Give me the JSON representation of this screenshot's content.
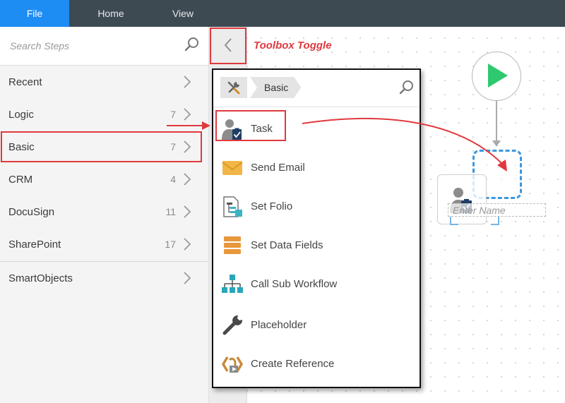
{
  "menu": {
    "file": "File",
    "home": "Home",
    "view": "View"
  },
  "search": {
    "placeholder": "Search Steps"
  },
  "categories": [
    {
      "label": "Recent",
      "count": ""
    },
    {
      "label": "Logic",
      "count": "7"
    },
    {
      "label": "Basic",
      "count": "7"
    },
    {
      "label": "CRM",
      "count": "4"
    },
    {
      "label": "DocuSign",
      "count": "11"
    },
    {
      "label": "SharePoint",
      "count": "17"
    },
    {
      "label": "SmartObjects",
      "count": ""
    }
  ],
  "callout": {
    "toolbox_toggle": "Toolbox Toggle"
  },
  "flyout": {
    "breadcrumb": "Basic",
    "steps": [
      {
        "label": "Task",
        "icon": "task-icon"
      },
      {
        "label": "Send Email",
        "icon": "email-icon"
      },
      {
        "label": "Set Folio",
        "icon": "folio-icon"
      },
      {
        "label": "Set Data Fields",
        "icon": "data-fields-icon"
      },
      {
        "label": "Call Sub Workflow",
        "icon": "sub-workflow-icon"
      },
      {
        "label": "Placeholder",
        "icon": "wrench-icon"
      },
      {
        "label": "Create Reference",
        "icon": "reference-icon"
      }
    ]
  },
  "canvas": {
    "name_placeholder": "Enter Name"
  },
  "colors": {
    "accent": "#1d8cf3",
    "highlight": "#e0393e",
    "start": "#2ec86e",
    "drop": "#3a97e0",
    "menubar": "#3e4a52"
  }
}
